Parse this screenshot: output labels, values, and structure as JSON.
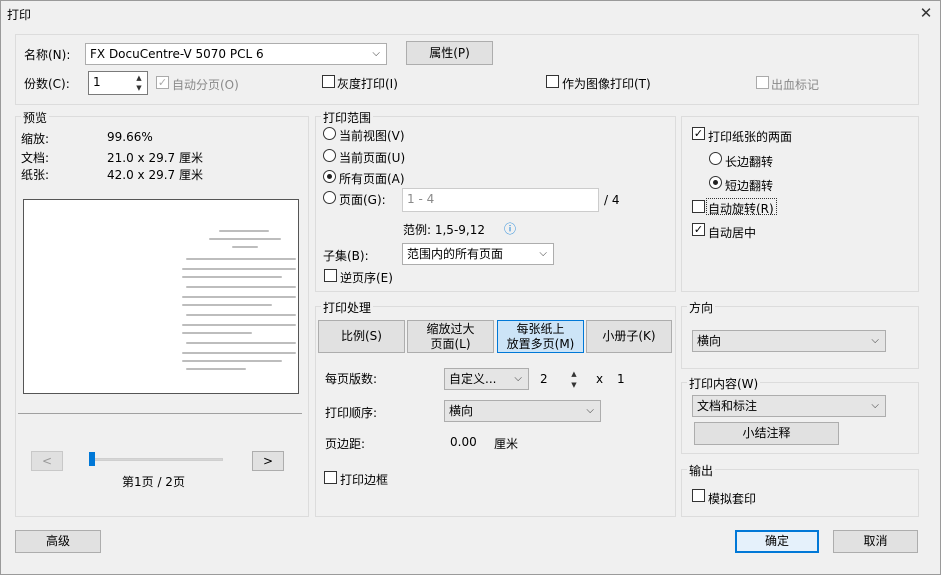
{
  "window": {
    "title": "打印",
    "close_glyph": "✕"
  },
  "printer": {
    "name_label": "名称(N):",
    "name_value": "FX DocuCentre-V 5070 PCL 6",
    "properties_button": "属性(P)",
    "copies_label": "份数(C):",
    "copies_value": "1",
    "collate_label": "自动分页(O)",
    "grayscale_label": "灰度打印(I)",
    "as_image_label": "作为图像打印(T)",
    "bleed_label": "出血标记"
  },
  "preview": {
    "group_label": "预览",
    "zoom_label": "缩放:",
    "zoom_value": "99.66%",
    "doc_label": "文档:",
    "doc_value": "21.0 x 29.7 厘米",
    "paper_label": "纸张:",
    "paper_value": "42.0 x 29.7 厘米",
    "prev_glyph": "<",
    "next_glyph": ">",
    "page_indicator": "第1页 / 2页",
    "slider_fraction": 0.0
  },
  "print_range": {
    "group_label": "打印范围",
    "current_view": "当前视图(V)",
    "current_page": "当前页面(U)",
    "all_pages": "所有页面(A)",
    "pages": "页面(G):",
    "pages_placeholder": "1 - 4",
    "pages_total": "/ 4",
    "example": "范例: 1,5-9,12",
    "info_glyph": "ⓘ",
    "subset_label": "子集(B):",
    "subset_value": "范围内的所有页面",
    "reverse_label": "逆页序(E)"
  },
  "print_handling": {
    "group_label": "打印处理",
    "tab_scale": "比例(S)",
    "tab_shrink_line1": "缩放过大",
    "tab_shrink_line2": "页面(L)",
    "tab_multiple_line1": "每张纸上",
    "tab_multiple_line2": "放置多页(M)",
    "tab_booklet": "小册子(K)",
    "pages_per_sheet_label": "每页版数:",
    "pages_per_sheet_value": "自定义...",
    "cols_value": "2",
    "times_glyph": "x",
    "rows_value": "1",
    "page_order_label": "打印顺序:",
    "page_order_value": "横向",
    "margin_label": "页边距:",
    "margin_value": "0.00",
    "margin_unit": "厘米",
    "border_label": "打印边框"
  },
  "duplex": {
    "both_sides_label": "打印纸张的两面",
    "long_edge": "长边翻转",
    "short_edge": "短边翻转",
    "auto_rotate": "自动旋转(R)",
    "auto_center": "自动居中"
  },
  "orientation": {
    "group_label": "方向",
    "value": "横向"
  },
  "content": {
    "group_label": "打印内容(W)",
    "value": "文档和标注",
    "summary_button": "小结注释"
  },
  "output": {
    "group_label": "输出",
    "simulate_label": "模拟套印"
  },
  "footer": {
    "advanced": "高级",
    "ok": "确定",
    "cancel": "取消"
  },
  "icons": {
    "check": "✓",
    "dropdown": "⌵",
    "spin_up": "▲",
    "spin_down": "▼"
  }
}
